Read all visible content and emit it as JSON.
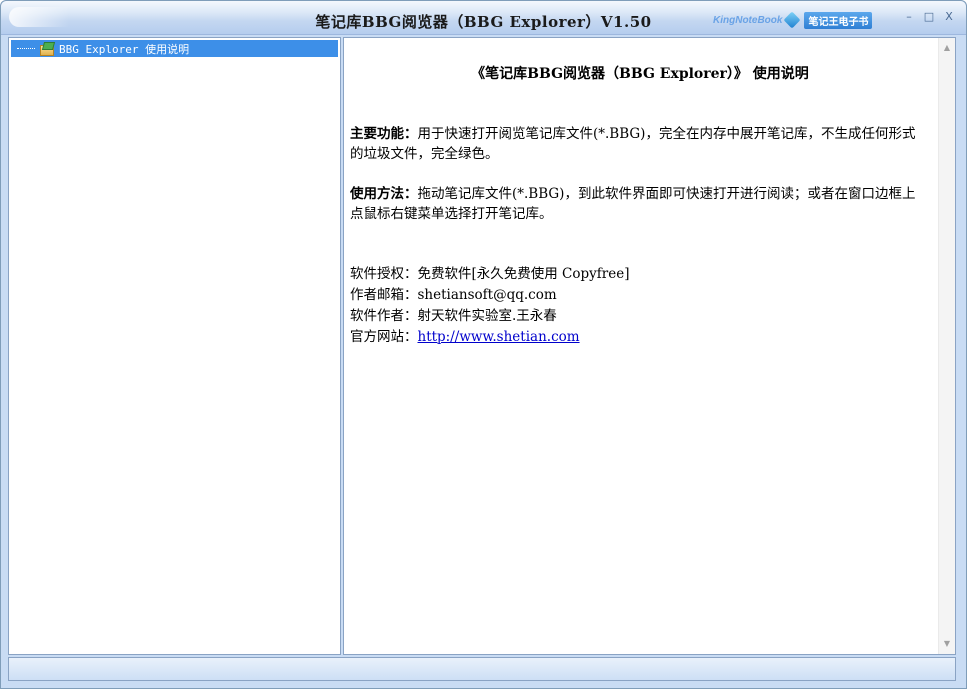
{
  "window": {
    "title": "笔记库BBG阅览器（BBG Explorer）V1.50",
    "brand_en": "KingNoteBook",
    "brand_cn": "笔记王电子书",
    "controls": {
      "minimize": "–",
      "maximize": "□",
      "close": "X"
    }
  },
  "tree": {
    "items": [
      {
        "label": "BBG Explorer 使用说明",
        "icon": "notebook-icon",
        "selected": true
      }
    ]
  },
  "document": {
    "title": "《笔记库BBG阅览器（BBG Explorer）》 使用说明",
    "features_label": "主要功能：",
    "features_text": "用于快速打开阅览笔记库文件(*.BBG)，完全在内存中展开笔记库，不生成任何形式的垃圾文件，完全绿色。",
    "usage_label": "使用方法：",
    "usage_text": "拖动笔记库文件(*.BBG)，到此软件界面即可快速打开进行阅读；或者在窗口边框上点鼠标右键菜单选择打开笔记库。",
    "license": "软件授权：免费软件[永久免费使用 Copyfree]",
    "email": "作者邮箱：shetiansoft@qq.com",
    "author": "软件作者：射天软件实验室.王永春",
    "website_label": "官方网站：",
    "website_url": "http://www.shetian.com"
  },
  "colors": {
    "selection": "#3d8fe8",
    "link": "#0000cc",
    "frame": "#c9dcf4"
  }
}
